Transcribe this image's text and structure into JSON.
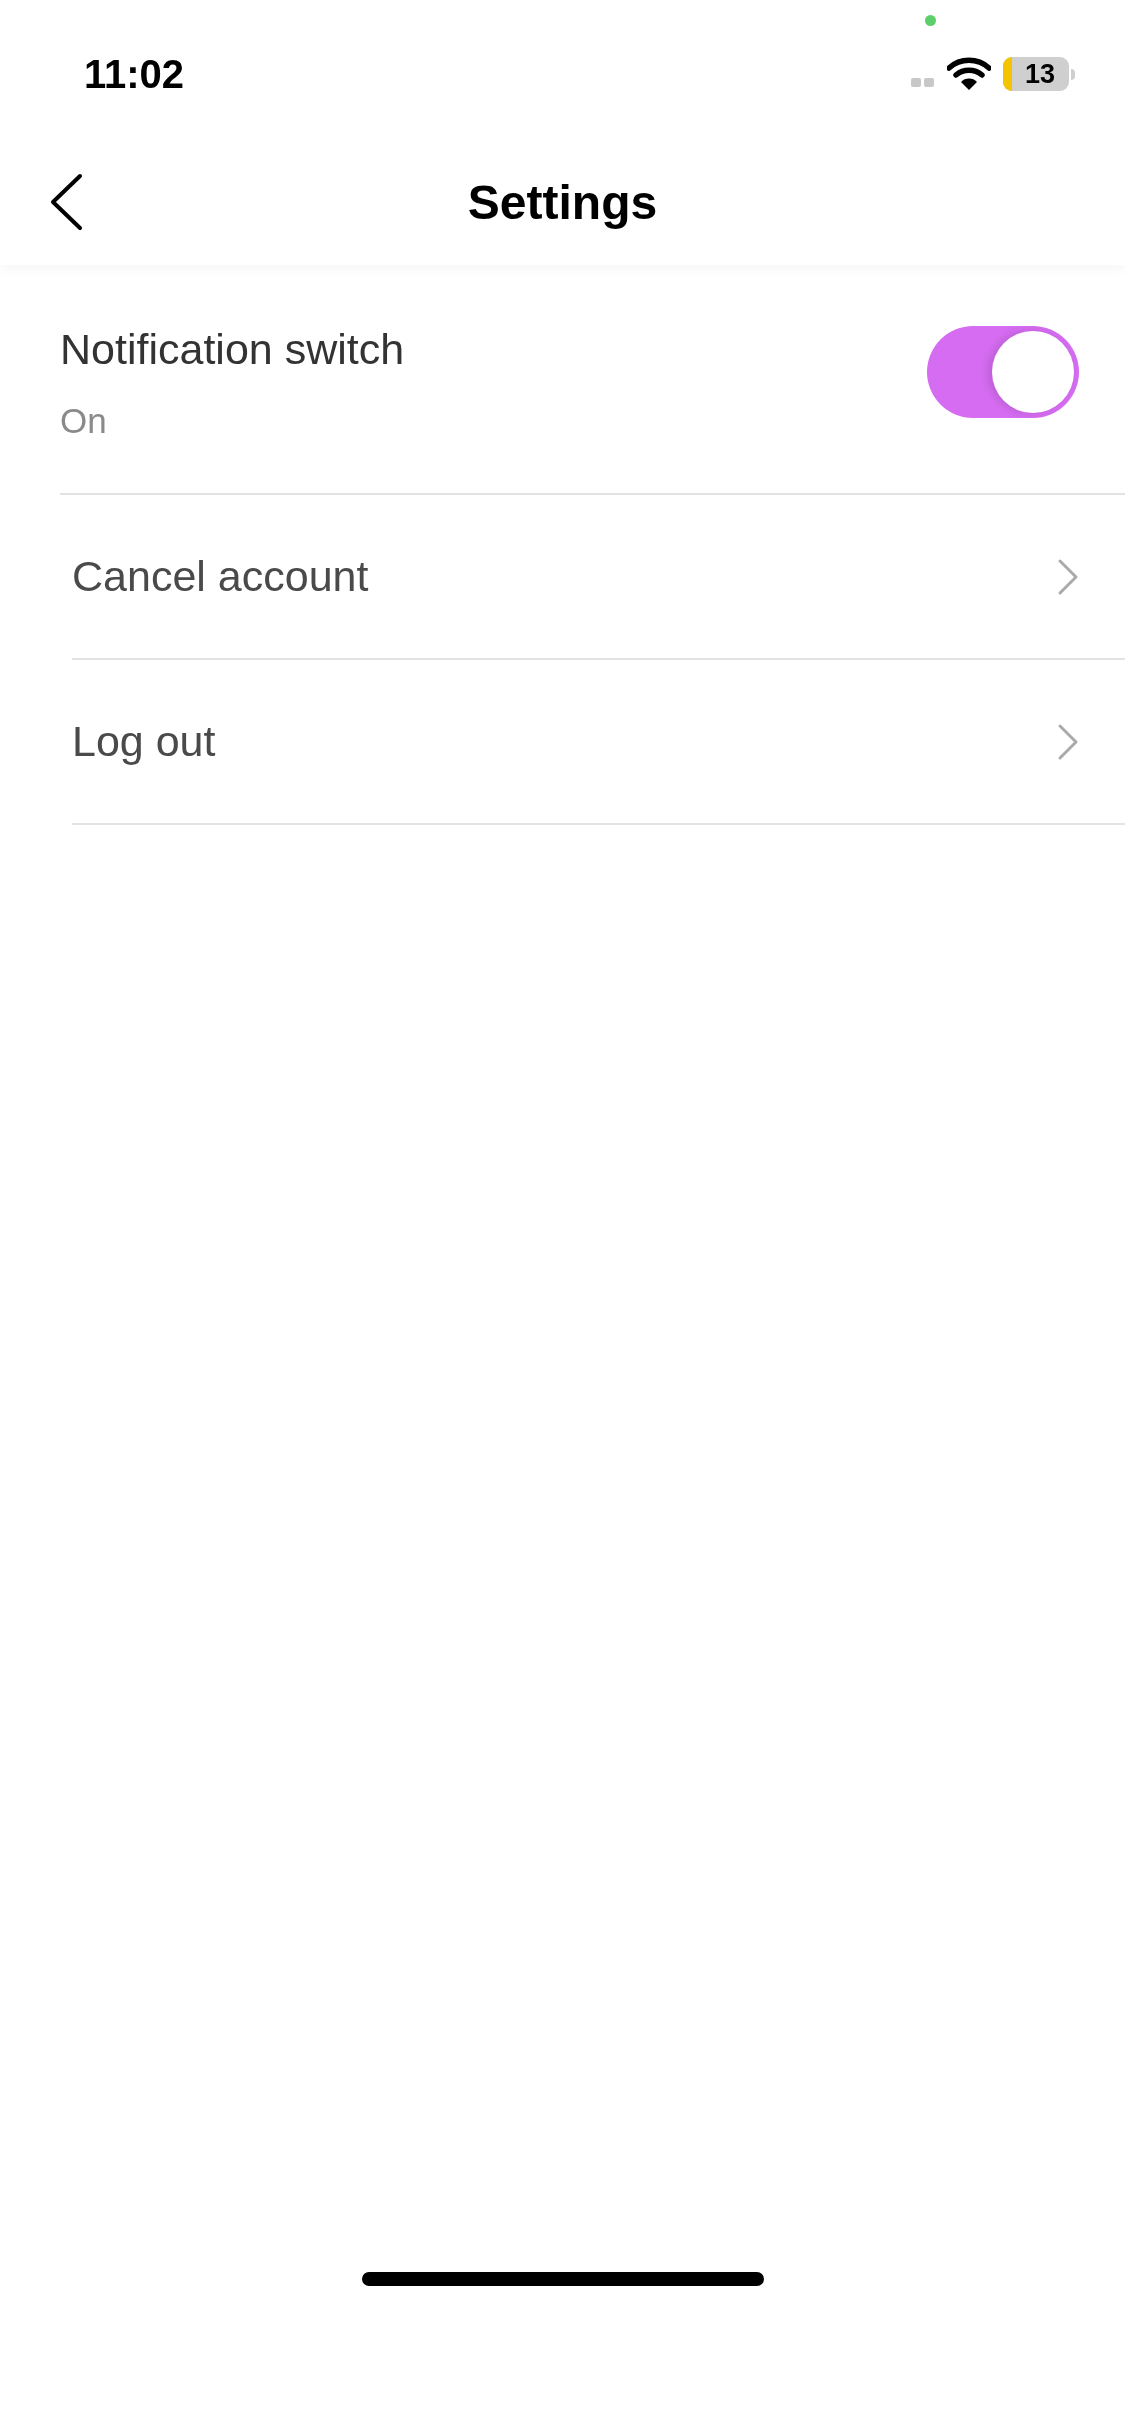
{
  "status_bar": {
    "time": "11:02",
    "battery": "13"
  },
  "nav": {
    "title": "Settings"
  },
  "notification": {
    "label": "Notification switch",
    "value": "On",
    "on": true
  },
  "items": [
    {
      "label": "Cancel account"
    },
    {
      "label": "Log out"
    }
  ]
}
